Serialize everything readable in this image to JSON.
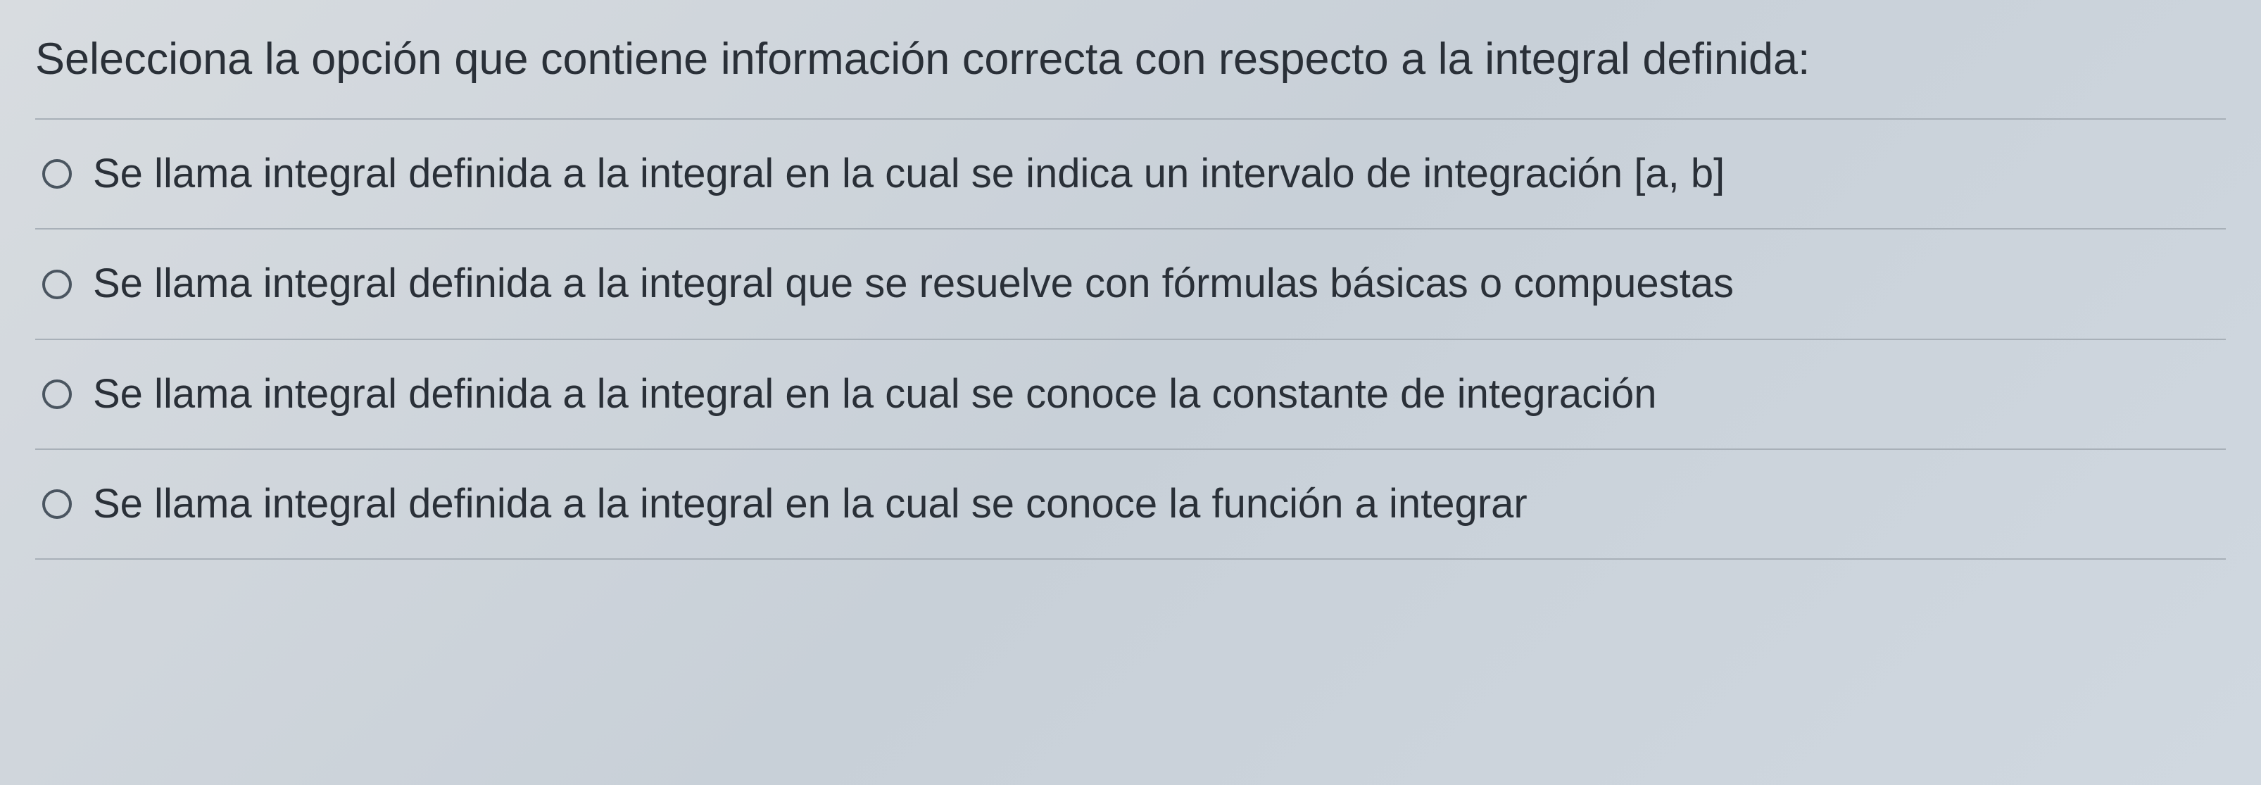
{
  "question": "Selecciona la opción que contiene información correcta con respecto a la integral definida:",
  "options": [
    {
      "label": "Se llama integral definida a la integral en la cual se indica un intervalo de integración [a, b]"
    },
    {
      "label": "Se llama integral definida a la integral que se resuelve con fórmulas básicas o compuestas"
    },
    {
      "label": "Se llama integral definida a la integral en la cual se conoce la constante de integración"
    },
    {
      "label": "Se llama integral definida a la integral en la cual se conoce la función a integrar"
    }
  ]
}
